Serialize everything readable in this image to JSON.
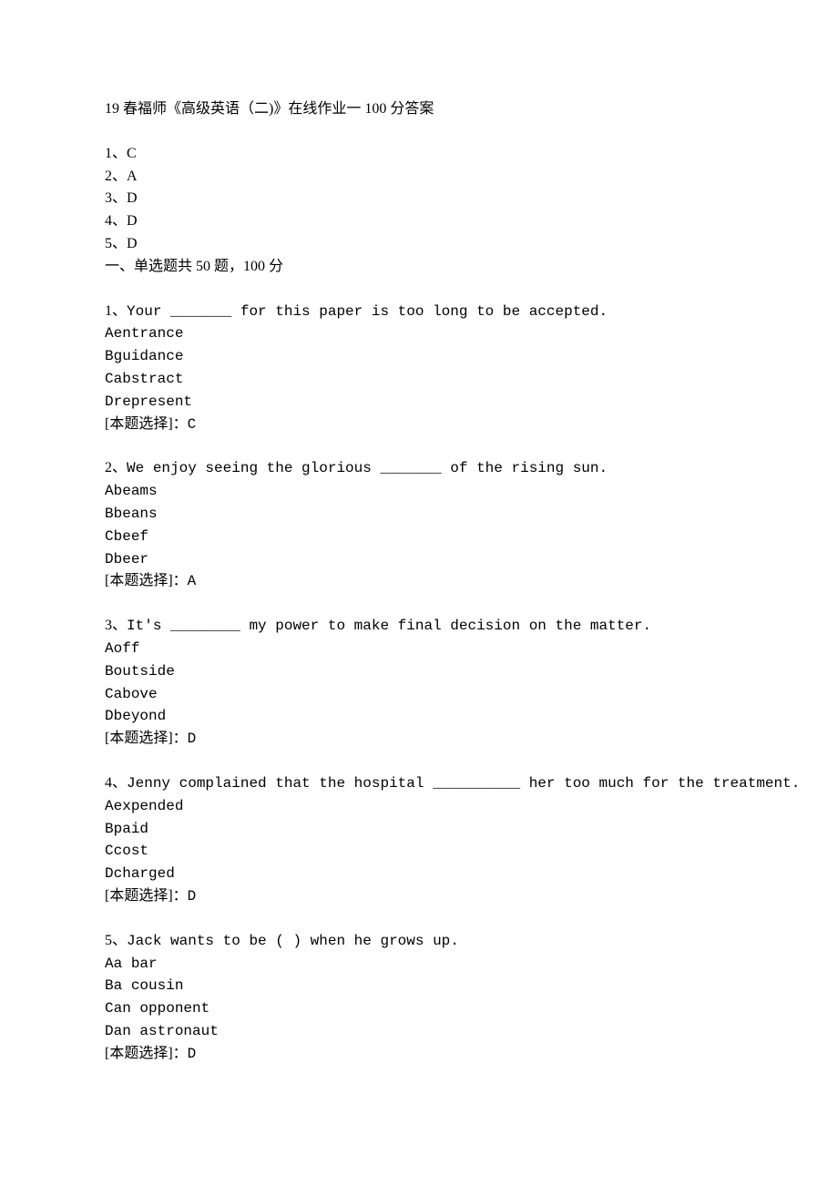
{
  "title": "19 春福师《高级英语（二)》在线作业一 100 分答案",
  "summary": {
    "lines": [
      "1、C",
      "2、A",
      "3、D",
      "4、D",
      "5、D"
    ],
    "section_header": "一、单选题共 50 题，100 分"
  },
  "questions": [
    {
      "num": "1",
      "text": "Your _______ for this paper is too long to be accepted.",
      "options": [
        {
          "letter": "A",
          "text": "entrance"
        },
        {
          "letter": "B",
          "text": "guidance"
        },
        {
          "letter": "C",
          "text": "abstract"
        },
        {
          "letter": "D",
          "text": "represent"
        }
      ],
      "answer_label": "[本题选择]：",
      "answer": "C"
    },
    {
      "num": "2",
      "text": "We enjoy seeing the glorious _______ of the rising sun.",
      "options": [
        {
          "letter": "A",
          "text": "beams"
        },
        {
          "letter": "B",
          "text": "beans"
        },
        {
          "letter": "C",
          "text": "beef"
        },
        {
          "letter": "D",
          "text": "beer"
        }
      ],
      "answer_label": "[本题选择]：",
      "answer": "A"
    },
    {
      "num": "3",
      "text": "It's ________ my power to make final decision on the matter.",
      "options": [
        {
          "letter": "A",
          "text": "off"
        },
        {
          "letter": "B",
          "text": "outside"
        },
        {
          "letter": "C",
          "text": "above"
        },
        {
          "letter": "D",
          "text": "beyond"
        }
      ],
      "answer_label": "[本题选择]：",
      "answer": "D"
    },
    {
      "num": "4",
      "text": "Jenny complained that the hospital __________ her too much for the treatment.",
      "options": [
        {
          "letter": "A",
          "text": "expended"
        },
        {
          "letter": "B",
          "text": "paid"
        },
        {
          "letter": "C",
          "text": "cost"
        },
        {
          "letter": "D",
          "text": "charged"
        }
      ],
      "answer_label": "[本题选择]：",
      "answer": "D"
    },
    {
      "num": "5",
      "text": "Jack wants to be ( ) when he grows up.",
      "options": [
        {
          "letter": "A",
          "text": "a bar"
        },
        {
          "letter": "B",
          "text": "a cousin"
        },
        {
          "letter": "C",
          "text": "an opponent"
        },
        {
          "letter": "D",
          "text": "an astronaut"
        }
      ],
      "answer_label": "[本题选择]：",
      "answer": "D"
    }
  ]
}
